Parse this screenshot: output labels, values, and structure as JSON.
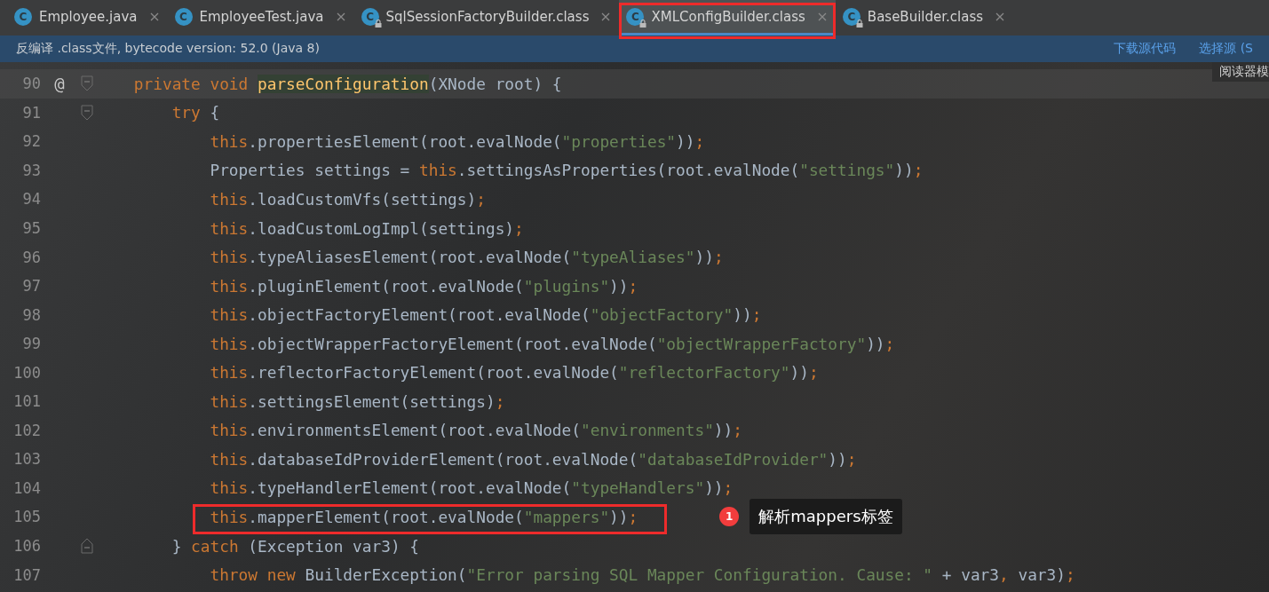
{
  "tabs": [
    {
      "label": "Employee.java",
      "icon": "C",
      "locked": false,
      "selected": false,
      "annotated": false
    },
    {
      "label": "EmployeeTest.java",
      "icon": "C",
      "locked": false,
      "selected": false,
      "annotated": false
    },
    {
      "label": "SqlSessionFactoryBuilder.class",
      "icon": "C",
      "locked": true,
      "selected": false,
      "annotated": false
    },
    {
      "label": "XMLConfigBuilder.class",
      "icon": "C",
      "locked": true,
      "selected": true,
      "annotated": true
    },
    {
      "label": "BaseBuilder.class",
      "icon": "C",
      "locked": true,
      "selected": false,
      "annotated": false
    }
  ],
  "info_bar": {
    "text": "反编译 .class文件, bytecode version: 52.0 (Java 8)",
    "links": [
      "下载源代码",
      "选择源 (S"
    ]
  },
  "reader_mode": "阅读器模",
  "lines": [
    {
      "number": "90",
      "current": true,
      "marker": "@",
      "fold_open": true,
      "tokens": [
        {
          "kind": "kw",
          "text": "    private void "
        },
        {
          "kind": "fn",
          "text": "parseConfiguration"
        },
        {
          "kind": "plain",
          "text": "(XNode root) {"
        }
      ]
    },
    {
      "number": "91",
      "current": false,
      "fold_open": true,
      "tokens": [
        {
          "kind": "kw",
          "text": "        try"
        },
        {
          "kind": "plain",
          "text": " {"
        }
      ]
    },
    {
      "number": "92",
      "current": false,
      "tokens": [
        {
          "kind": "kw",
          "text": "            this"
        },
        {
          "kind": "plain",
          "text": ".propertiesElement(root.evalNode("
        },
        {
          "kind": "str",
          "text": "\"properties\""
        },
        {
          "kind": "plain",
          "text": "))"
        },
        {
          "kind": "kw",
          "text": ";"
        }
      ]
    },
    {
      "number": "93",
      "current": false,
      "tokens": [
        {
          "kind": "plain",
          "text": "            Properties settings = "
        },
        {
          "kind": "kw",
          "text": "this"
        },
        {
          "kind": "plain",
          "text": ".settingsAsProperties(root.evalNode("
        },
        {
          "kind": "str",
          "text": "\"settings\""
        },
        {
          "kind": "plain",
          "text": "))"
        },
        {
          "kind": "kw",
          "text": ";"
        }
      ]
    },
    {
      "number": "94",
      "current": false,
      "tokens": [
        {
          "kind": "kw",
          "text": "            this"
        },
        {
          "kind": "plain",
          "text": ".loadCustomVfs(settings)"
        },
        {
          "kind": "kw",
          "text": ";"
        }
      ]
    },
    {
      "number": "95",
      "current": false,
      "tokens": [
        {
          "kind": "kw",
          "text": "            this"
        },
        {
          "kind": "plain",
          "text": ".loadCustomLogImpl(settings)"
        },
        {
          "kind": "kw",
          "text": ";"
        }
      ]
    },
    {
      "number": "96",
      "current": false,
      "tokens": [
        {
          "kind": "kw",
          "text": "            this"
        },
        {
          "kind": "plain",
          "text": ".typeAliasesElement(root.evalNode("
        },
        {
          "kind": "str",
          "text": "\"typeAliases\""
        },
        {
          "kind": "plain",
          "text": "))"
        },
        {
          "kind": "kw",
          "text": ";"
        }
      ]
    },
    {
      "number": "97",
      "current": false,
      "tokens": [
        {
          "kind": "kw",
          "text": "            this"
        },
        {
          "kind": "plain",
          "text": ".pluginElement(root.evalNode("
        },
        {
          "kind": "str",
          "text": "\"plugins\""
        },
        {
          "kind": "plain",
          "text": "))"
        },
        {
          "kind": "kw",
          "text": ";"
        }
      ]
    },
    {
      "number": "98",
      "current": false,
      "tokens": [
        {
          "kind": "kw",
          "text": "            this"
        },
        {
          "kind": "plain",
          "text": ".objectFactoryElement(root.evalNode("
        },
        {
          "kind": "str",
          "text": "\"objectFactory\""
        },
        {
          "kind": "plain",
          "text": "))"
        },
        {
          "kind": "kw",
          "text": ";"
        }
      ]
    },
    {
      "number": "99",
      "current": false,
      "tokens": [
        {
          "kind": "kw",
          "text": "            this"
        },
        {
          "kind": "plain",
          "text": ".objectWrapperFactoryElement(root.evalNode("
        },
        {
          "kind": "str",
          "text": "\"objectWrapperFactory\""
        },
        {
          "kind": "plain",
          "text": "))"
        },
        {
          "kind": "kw",
          "text": ";"
        }
      ]
    },
    {
      "number": "100",
      "current": false,
      "tokens": [
        {
          "kind": "kw",
          "text": "            this"
        },
        {
          "kind": "plain",
          "text": ".reflectorFactoryElement(root.evalNode("
        },
        {
          "kind": "str",
          "text": "\"reflectorFactory\""
        },
        {
          "kind": "plain",
          "text": "))"
        },
        {
          "kind": "kw",
          "text": ";"
        }
      ]
    },
    {
      "number": "101",
      "current": false,
      "tokens": [
        {
          "kind": "kw",
          "text": "            this"
        },
        {
          "kind": "plain",
          "text": ".settingsElement(settings)"
        },
        {
          "kind": "kw",
          "text": ";"
        }
      ]
    },
    {
      "number": "102",
      "current": false,
      "tokens": [
        {
          "kind": "kw",
          "text": "            this"
        },
        {
          "kind": "plain",
          "text": ".environmentsElement(root.evalNode("
        },
        {
          "kind": "str",
          "text": "\"environments\""
        },
        {
          "kind": "plain",
          "text": "))"
        },
        {
          "kind": "kw",
          "text": ";"
        }
      ]
    },
    {
      "number": "103",
      "current": false,
      "tokens": [
        {
          "kind": "kw",
          "text": "            this"
        },
        {
          "kind": "plain",
          "text": ".databaseIdProviderElement(root.evalNode("
        },
        {
          "kind": "str",
          "text": "\"databaseIdProvider\""
        },
        {
          "kind": "plain",
          "text": "))"
        },
        {
          "kind": "kw",
          "text": ";"
        }
      ]
    },
    {
      "number": "104",
      "current": false,
      "tokens": [
        {
          "kind": "kw",
          "text": "            this"
        },
        {
          "kind": "plain",
          "text": ".typeHandlerElement(root.evalNode("
        },
        {
          "kind": "str",
          "text": "\"typeHandlers\""
        },
        {
          "kind": "plain",
          "text": "))"
        },
        {
          "kind": "kw",
          "text": ";"
        }
      ]
    },
    {
      "number": "105",
      "current": false,
      "note": {
        "badge": "1",
        "text": "解析mappers标签"
      },
      "tokens": [
        {
          "kind": "kw",
          "text": "            this",
          "boxed": true
        },
        {
          "kind": "plain",
          "text": ".mapperElement(root.evalNode(",
          "boxed": true
        },
        {
          "kind": "str",
          "text": "\"mappers\"",
          "boxed": true
        },
        {
          "kind": "plain",
          "text": "))",
          "boxed": true
        },
        {
          "kind": "kw",
          "text": ";",
          "boxed": true
        }
      ]
    },
    {
      "number": "106",
      "current": false,
      "fold_close": true,
      "tokens": [
        {
          "kind": "plain",
          "text": "        } "
        },
        {
          "kind": "kw",
          "text": "catch"
        },
        {
          "kind": "plain",
          "text": " (Exception var3) {"
        }
      ]
    },
    {
      "number": "107",
      "current": false,
      "tokens": [
        {
          "kind": "kw",
          "text": "            throw new"
        },
        {
          "kind": "plain",
          "text": " BuilderException("
        },
        {
          "kind": "str",
          "text": "\"Error parsing SQL Mapper Configuration. Cause: \""
        },
        {
          "kind": "plain",
          "text": " + var3"
        },
        {
          "kind": "kw",
          "text": ","
        },
        {
          "kind": "plain",
          "text": " var3)"
        },
        {
          "kind": "kw",
          "text": ";"
        }
      ]
    }
  ]
}
